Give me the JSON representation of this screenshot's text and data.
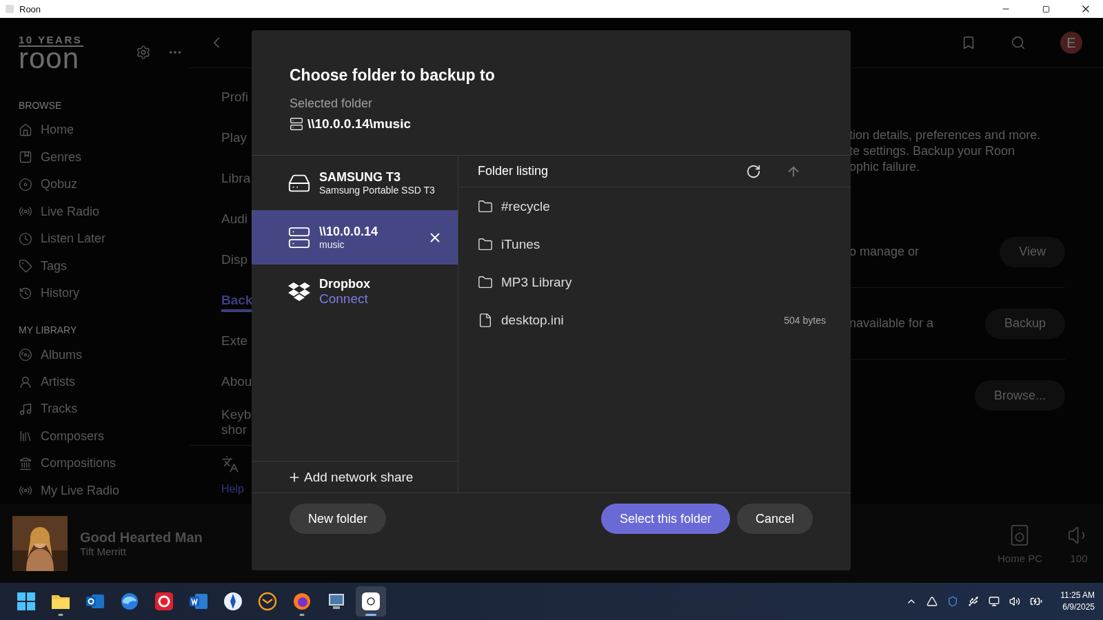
{
  "window": {
    "title": "Roon"
  },
  "sidebar": {
    "logo": {
      "tagline": "10 YEARS",
      "wordmark": "roon"
    },
    "sections": [
      {
        "title": "BROWSE",
        "items": [
          {
            "label": "Home"
          },
          {
            "label": "Genres"
          },
          {
            "label": "Qobuz"
          },
          {
            "label": "Live Radio"
          },
          {
            "label": "Listen Later"
          },
          {
            "label": "Tags"
          },
          {
            "label": "History"
          }
        ]
      },
      {
        "title": "MY LIBRARY",
        "items": [
          {
            "label": "Albums"
          },
          {
            "label": "Artists"
          },
          {
            "label": "Tracks"
          },
          {
            "label": "Composers"
          },
          {
            "label": "Compositions"
          },
          {
            "label": "My Live Radio"
          }
        ]
      }
    ]
  },
  "header": {
    "avatar": "E"
  },
  "settings_nav": [
    {
      "label": "Profi",
      "selected": false
    },
    {
      "label": "Play",
      "selected": false
    },
    {
      "label": "Libra",
      "selected": false
    },
    {
      "label": "Audi",
      "selected": false
    },
    {
      "label": "Disp",
      "selected": false
    },
    {
      "label": "Back",
      "selected": true
    },
    {
      "label": "Exte",
      "selected": false
    },
    {
      "label": "Abou",
      "selected": false
    },
    {
      "label": "Keyb\nshor",
      "selected": false
    }
  ],
  "help_link": "Help",
  "settings_panel": {
    "description": [
      "tion details, preferences and more.",
      "te settings. Backup your Roon",
      "ophic failure."
    ],
    "rows": [
      {
        "text": "o manage or",
        "button": "View"
      },
      {
        "text": "navailable for a",
        "button": "Backup"
      },
      {
        "button": "Browse..."
      }
    ]
  },
  "dialog": {
    "title": "Choose folder to backup to",
    "selected_label": "Selected folder",
    "selected_path": "\\\\10.0.0.14\\music",
    "locations": [
      {
        "kind": "drive",
        "title": "SAMSUNG T3",
        "subtitle": "Samsung Portable SSD T3",
        "selected": false,
        "removable": false
      },
      {
        "kind": "share",
        "title": "\\\\10.0.0.14",
        "subtitle": "music",
        "selected": true,
        "removable": true
      },
      {
        "kind": "cloud",
        "title": "Dropbox",
        "link": "Connect",
        "selected": false,
        "removable": false
      }
    ],
    "add_share": "Add network share",
    "listing_title": "Folder listing",
    "entries": [
      {
        "kind": "folder",
        "name": "#recycle"
      },
      {
        "kind": "folder",
        "name": "iTunes"
      },
      {
        "kind": "folder",
        "name": "MP3 Library"
      },
      {
        "kind": "file",
        "name": "desktop.ini",
        "size": "504 bytes"
      }
    ],
    "buttons": [
      {
        "kind": "secondary",
        "label": "New folder"
      },
      {
        "kind": "primary",
        "label": "Select this folder"
      },
      {
        "kind": "secondary",
        "label": "Cancel"
      }
    ]
  },
  "now_playing": {
    "title": "Good Hearted Man",
    "artist": "Tift Merritt",
    "zone": "Home PC",
    "volume": "100"
  },
  "taskbar": {
    "apps": [
      {
        "kind": "start",
        "selected": false,
        "running": false
      },
      {
        "kind": "files",
        "selected": false,
        "running": true
      },
      {
        "kind": "outlook",
        "selected": false,
        "running": false
      },
      {
        "kind": "globe",
        "selected": false,
        "running": false
      },
      {
        "kind": "red",
        "selected": false,
        "running": false
      },
      {
        "kind": "word",
        "selected": false,
        "running": false
      },
      {
        "kind": "pen",
        "selected": false,
        "running": false
      },
      {
        "kind": "mail",
        "selected": false,
        "running": false
      },
      {
        "kind": "firefox",
        "selected": false,
        "running": true
      },
      {
        "kind": "monitor",
        "selected": false,
        "running": false
      },
      {
        "kind": "roon",
        "selected": true,
        "running": true
      }
    ],
    "time": "11:25 AM",
    "date": "6/9/2025"
  }
}
